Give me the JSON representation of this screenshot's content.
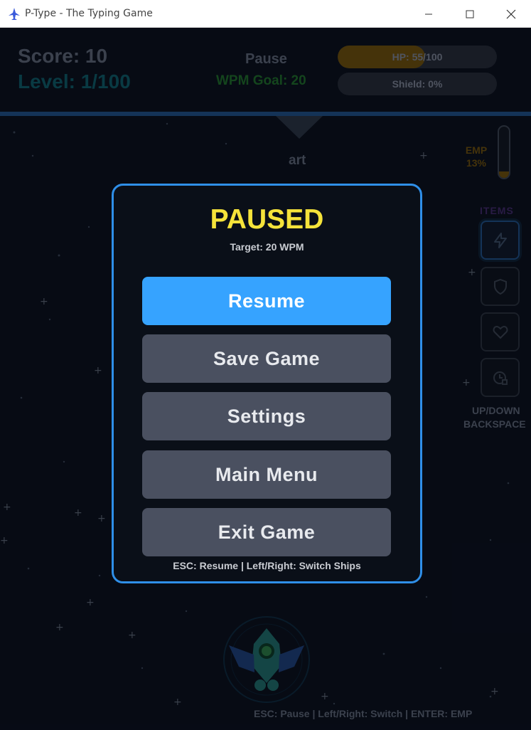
{
  "window": {
    "title": "P-Type - The Typing Game",
    "icon": "rocket-icon"
  },
  "hud": {
    "score": "Score: 10",
    "level": "Level: 1/100",
    "state": "Pause",
    "wpm_goal": "WPM Goal: 20",
    "hp": {
      "text": "HP: 55/100",
      "fraction": 0.55
    },
    "shield": {
      "text": "Shield: 0%",
      "fraction": 0
    },
    "current_word": "art",
    "emp": {
      "label": "EMP",
      "percent_text": "13%",
      "fraction": 0.13
    },
    "items_label": "ITEMS",
    "items": [
      "lightning-icon",
      "shield-icon",
      "heart-icon",
      "clock-icon"
    ],
    "item_hint_1": "UP/DOWN",
    "item_hint_2": "BACKSPACE",
    "controls_hint": "ESC: Pause | Left/Right: Switch | ENTER: EMP"
  },
  "pause_menu": {
    "title": "PAUSED",
    "target": "Target: 20 WPM",
    "buttons": [
      "Resume",
      "Save Game",
      "Settings",
      "Main Menu",
      "Exit Game"
    ],
    "hint": "ESC: Resume | Left/Right: Switch Ships"
  },
  "colors": {
    "accent": "#2f8fe8",
    "primary_button": "#36a3ff",
    "title_yellow": "#f5e33a",
    "button_gray": "#4a5060"
  }
}
